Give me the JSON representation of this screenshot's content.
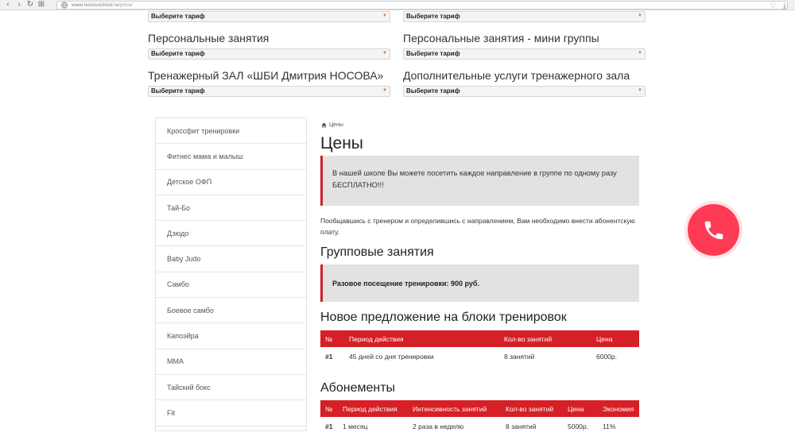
{
  "browser": {
    "url_host": "www.nosovschool.ru",
    "url_path": "/price/"
  },
  "tariffs": {
    "top_left_select": "Выберите тариф",
    "top_right_select": "Выберите тариф",
    "rows": [
      {
        "label": "Персональные занятия",
        "select": "Выберите тариф"
      },
      {
        "label": "Персональные занятия - мини группы",
        "select": "Выберите тариф"
      },
      {
        "label": "Тренажерный ЗАЛ «ШБИ Дмитрия НОСОВА»",
        "select": "Выберите тариф"
      },
      {
        "label": "Дополнительные услуги тренажерного зала",
        "select": "Выберите тариф"
      }
    ]
  },
  "sidebar": {
    "items": [
      "Кроссфит тренировки",
      "Фитнес мама и малыш",
      "Детское ОФП",
      "Тай-Бо",
      "Дзюдо",
      "Baby Judo",
      "Самбо",
      "Боевое самбо",
      "Капоэйра",
      "ММА",
      "Тайский бокс",
      "Fit"
    ]
  },
  "main": {
    "breadcrumb": "Цены",
    "title": "Цены",
    "notice": "В нашей школе Вы можете посетить каждое направление в группе по одному разу БЕСПЛАТНО!!!",
    "intro": "Пообщавшись с тренером и определившись с направлением, Вам необходимо внести абонентскую плату.",
    "group_heading": "Групповые занятия",
    "single_visit": "Разовое посещение тренировки: 900 руб.",
    "blocks_heading": "Новое предложение на блоки тренировок",
    "blocks_table": {
      "headers": [
        "№",
        "Период действия",
        "Кол-во занятий",
        "Цена"
      ],
      "rows": [
        [
          "#1",
          "45 дней со дня тренировки",
          "8 занятий",
          "6000р."
        ]
      ]
    },
    "subscriptions_heading": "Абонементы",
    "subscriptions_table": {
      "headers": [
        "№",
        "Период действия",
        "Интенсивность занятий",
        "Кол-во занятий",
        "Цена",
        "Экономия"
      ],
      "rows": [
        [
          "#1",
          "1 месяц",
          "2 раза в неделю",
          "8 занятий",
          "5000р.",
          "11%"
        ]
      ]
    }
  },
  "colors": {
    "accent_red": "#d61f26",
    "call_button": "#fe3a55"
  }
}
